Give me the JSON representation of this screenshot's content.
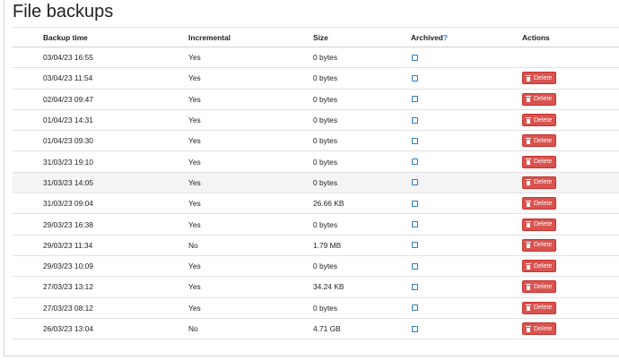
{
  "page": {
    "title": "File backups"
  },
  "table": {
    "headers": {
      "backup_time": "Backup time",
      "incremental": "Incremental",
      "size": "Size",
      "archived": "Archived",
      "archived_help": "?",
      "actions": "Actions"
    },
    "delete_label": "Delete",
    "rows": [
      {
        "time": "03/04/23 16:55",
        "incremental": "Yes",
        "size": "0 bytes",
        "archived": false,
        "deletable": false
      },
      {
        "time": "03/04/23 11:54",
        "incremental": "Yes",
        "size": "0 bytes",
        "archived": false,
        "deletable": true
      },
      {
        "time": "02/04/23 09:47",
        "incremental": "Yes",
        "size": "0 bytes",
        "archived": false,
        "deletable": true
      },
      {
        "time": "01/04/23 14:31",
        "incremental": "Yes",
        "size": "0 bytes",
        "archived": false,
        "deletable": true
      },
      {
        "time": "01/04/23 09:30",
        "incremental": "Yes",
        "size": "0 bytes",
        "archived": false,
        "deletable": true
      },
      {
        "time": "31/03/23 19:10",
        "incremental": "Yes",
        "size": "0 bytes",
        "archived": false,
        "deletable": true
      },
      {
        "time": "31/03/23 14:05",
        "incremental": "Yes",
        "size": "0 bytes",
        "archived": false,
        "deletable": true,
        "highlight": true
      },
      {
        "time": "31/03/23 09:04",
        "incremental": "Yes",
        "size": "26.66 KB",
        "archived": false,
        "deletable": true
      },
      {
        "time": "29/03/23 16:38",
        "incremental": "Yes",
        "size": "0 bytes",
        "archived": false,
        "deletable": true
      },
      {
        "time": "29/03/23 11:34",
        "incremental": "No",
        "size": "1.79 MB",
        "archived": false,
        "deletable": true
      },
      {
        "time": "29/03/23 10:09",
        "incremental": "Yes",
        "size": "0 bytes",
        "archived": false,
        "deletable": true
      },
      {
        "time": "27/03/23 13:12",
        "incremental": "Yes",
        "size": "34.24 KB",
        "archived": false,
        "deletable": true
      },
      {
        "time": "27/03/23 08:12",
        "incremental": "Yes",
        "size": "0 bytes",
        "archived": false,
        "deletable": true
      },
      {
        "time": "26/03/23 13:04",
        "incremental": "No",
        "size": "4.71 GB",
        "archived": false,
        "deletable": true
      }
    ]
  },
  "colors": {
    "delete": "#d9534f",
    "help": "#2a7ab8"
  }
}
